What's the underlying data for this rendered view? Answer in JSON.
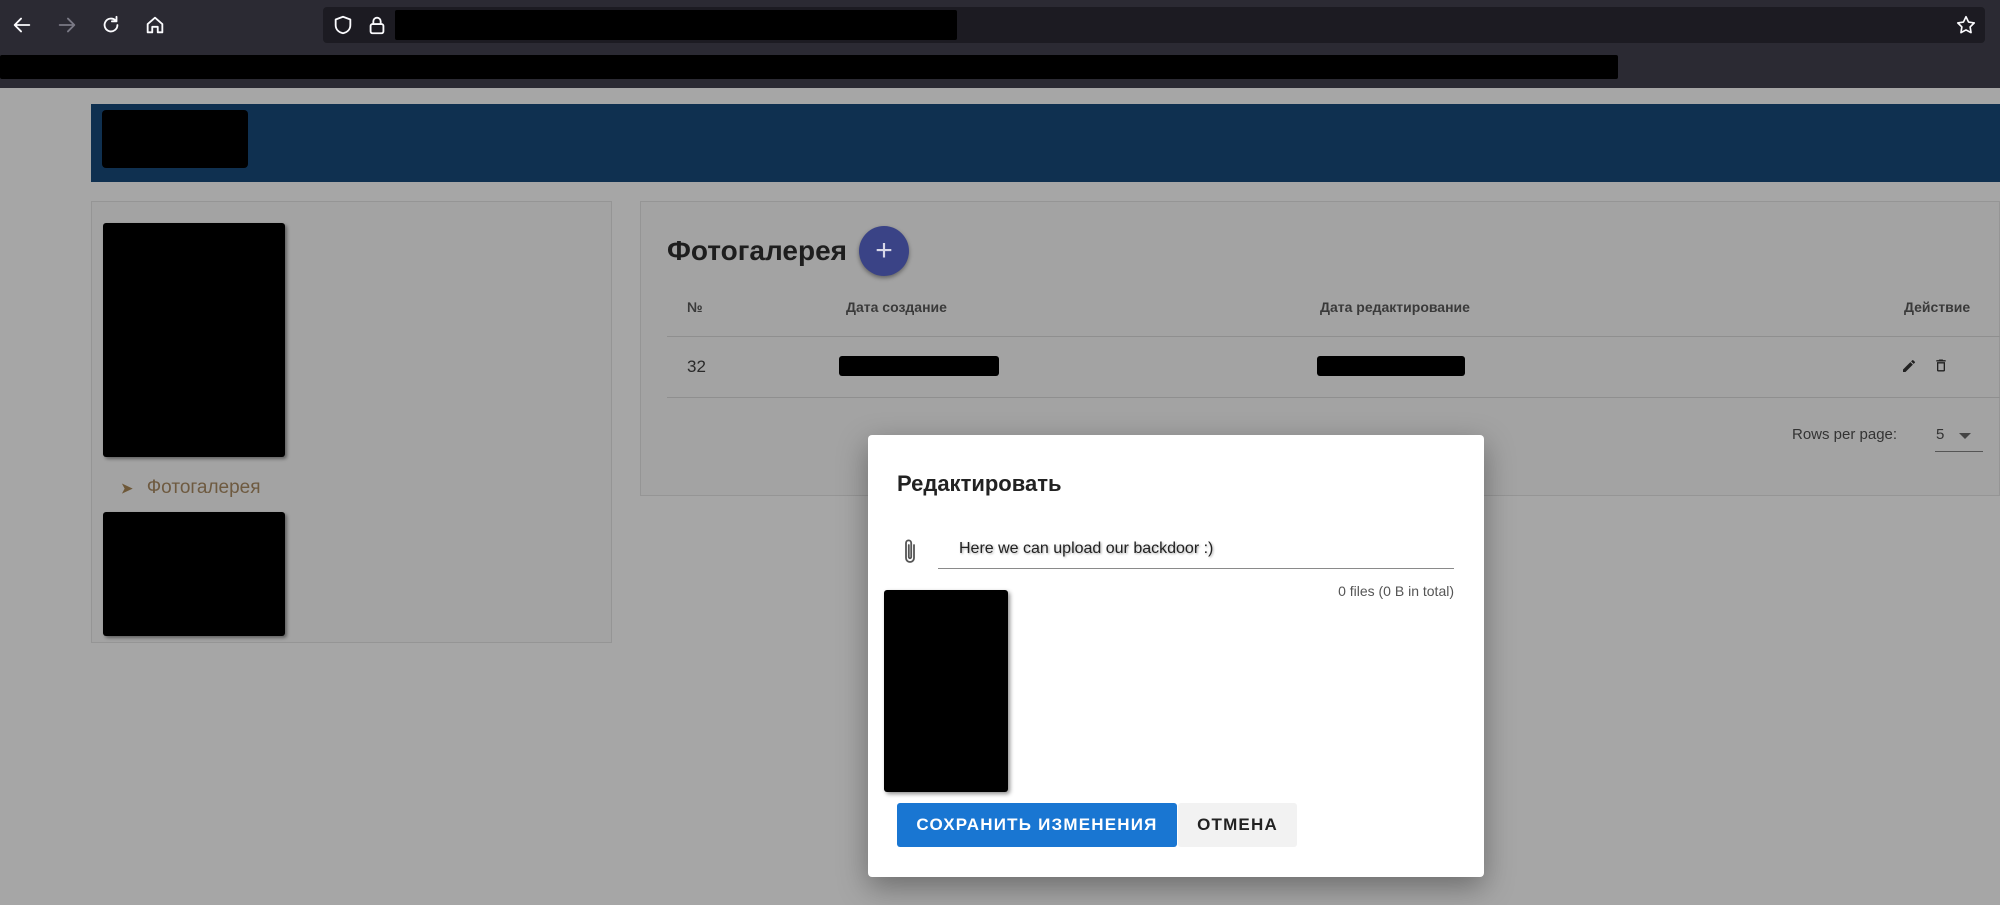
{
  "browser": {
    "icons": [
      "back-arrow-icon",
      "forward-arrow-icon",
      "reload-icon",
      "home-icon",
      "shield-icon",
      "lock-icon",
      "star-icon"
    ]
  },
  "gallery": {
    "sidebar_item": "Фотогалерея",
    "title": "Фотогалерея",
    "add_label": "+",
    "columns": [
      "№",
      "Дата создание",
      "Дата редактирование",
      "Действие"
    ],
    "rows": [
      {
        "num": "32"
      }
    ],
    "rows_per_page_label": "Rows per page:",
    "rows_per_page_value": "5"
  },
  "dialog": {
    "title": "Редактировать",
    "file_input_text": "Here we can upload our backdoor :)",
    "file_count": "0 files (0 B in total)",
    "save_label": "СОХРАНИТЬ ИЗМЕНЕНИЯ",
    "cancel_label": "ОТМЕНА"
  },
  "colors": {
    "header_blue": "#0f3050",
    "save_blue": "#1976d2",
    "add_button": "#3a4386"
  }
}
